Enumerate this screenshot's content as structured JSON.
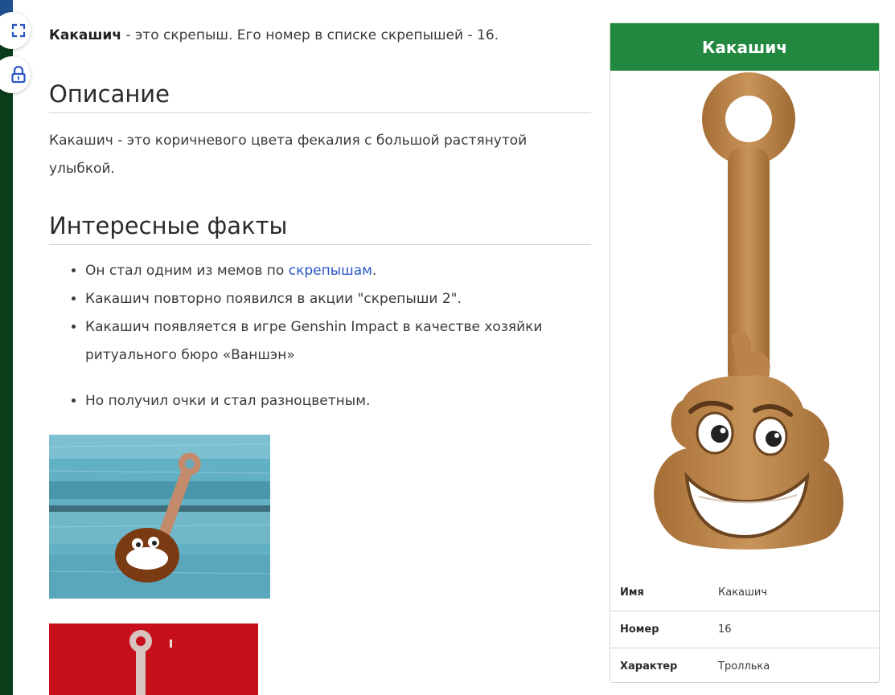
{
  "intro": {
    "name": "Какашич",
    "text": " - это скрепыш. Его номер в списке скрепышей - 16."
  },
  "description": {
    "heading": "Описание",
    "text": "Какашич - это коричневого цвета фекалия с большой растянутой улыбкой."
  },
  "facts": {
    "heading": "Интересные факты",
    "item1_before": "Он стал одним из мемов по ",
    "item1_link": "скрепышам",
    "item1_after": ".",
    "item2": "Какашич повторно появился в акции \"скрепыши 2\".",
    "item3": "Какашич появляется в игре Genshin Impact в качестве хозяйки ритуального бюро «Ваншэн»",
    "item4": "Но получил очки и стал разноцветным."
  },
  "infobox": {
    "title": "Какашич",
    "rows": [
      {
        "key": "Имя",
        "value": "Какашич"
      },
      {
        "key": "Номер",
        "value": "16"
      },
      {
        "key": "Характер",
        "value": "Троллька"
      }
    ]
  },
  "colors": {
    "accent_green": "#22883f",
    "link_blue": "#2a56c6",
    "toy_brown": "#b7834a"
  },
  "icons": {
    "expand": "expand-icon",
    "lock": "lock-icon"
  }
}
